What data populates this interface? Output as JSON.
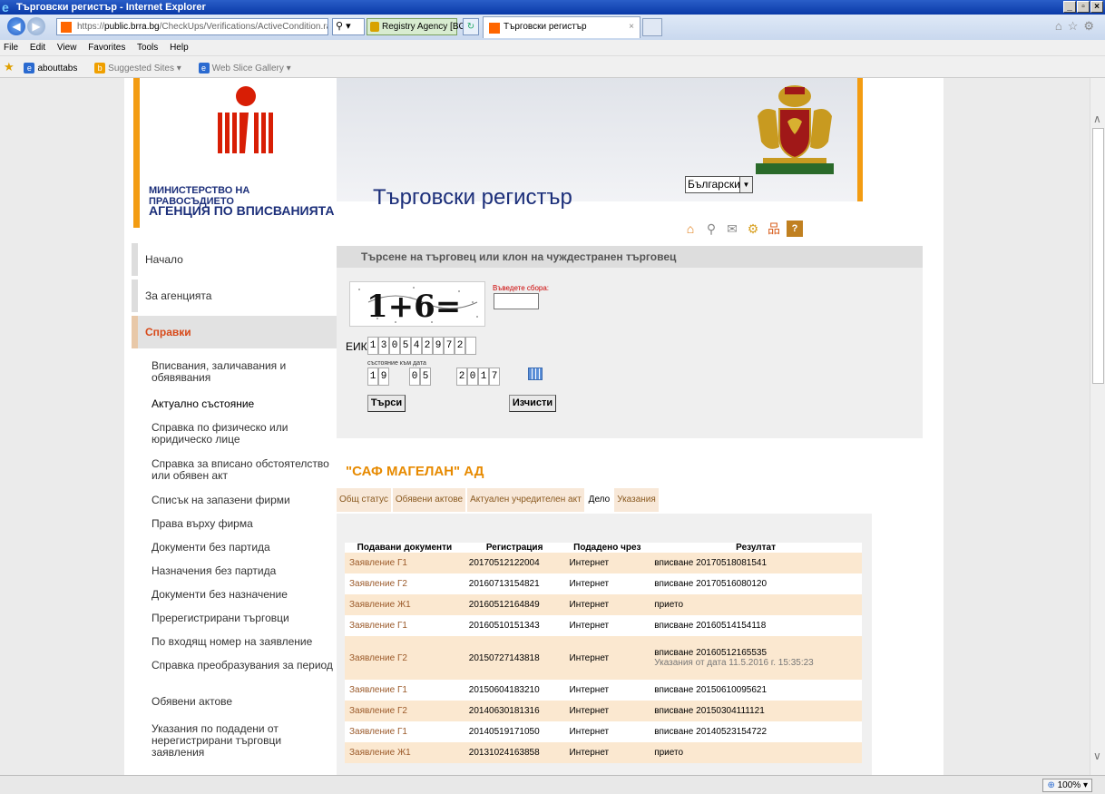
{
  "window": {
    "title": "Търговски регистър - Internet Explorer"
  },
  "browser": {
    "url_prefix": "https://",
    "url_domain": "public.brra.bg",
    "url_path": "/CheckUps/Verifications/ActiveCondition.ra",
    "cert_label": "Registry Agency [BG]",
    "tab_title": "Търговски регистър",
    "menu": [
      "File",
      "Edit",
      "View",
      "Favorites",
      "Tools",
      "Help"
    ],
    "favorites": [
      "abouttabs",
      "Suggested Sites ▾",
      "Web Slice Gallery ▾"
    ],
    "zoom": "100%"
  },
  "header": {
    "ministry": "МИНИСТЕРСТВО НА ПРАВОСЪДИЕТО",
    "agency": "АГЕНЦИЯ ПО ВПИСВАНИЯТА",
    "register_title": "Търговски регистър",
    "language": "Български"
  },
  "sidebar": {
    "home": "Начало",
    "about": "За агенцията",
    "section": "Справки",
    "items": [
      "Вписвания, заличавания и обявявания",
      "Актуално състояние",
      "Справка по физическо или юридическо лице",
      "Справка за вписано обстоятелство или обявен акт",
      "Списък на запазени фирми",
      "Права върху фирма",
      "Документи без партида",
      "Назначения без партида",
      "Документи без назначение",
      "Пререгистрирани търговци",
      "По входящ номер на заявление",
      "Справка преобразувания за период",
      "Обявени актове",
      "Указания по подадени от нерегистрирани търговци заявления"
    ]
  },
  "search": {
    "heading": "Търсене на търговец или клон на чуждестранен търговец",
    "captcha_label": "Въведете сбора:",
    "captcha_text": "1+6=",
    "eik_label": "ЕИК:",
    "eik_digits": [
      "1",
      "3",
      "0",
      "5",
      "4",
      "2",
      "9",
      "7",
      "2",
      ""
    ],
    "date_caption": "състояние към дата",
    "day": [
      "1",
      "9"
    ],
    "month": [
      "0",
      "5"
    ],
    "year": [
      "2",
      "0",
      "1",
      "7"
    ],
    "search_button": "Търси",
    "clear_button": "Изчисти"
  },
  "company": {
    "name": "\"САФ МАГЕЛАН\" АД"
  },
  "tabs": [
    "Общ статус",
    "Обявени актове",
    "Актуален учредителен акт",
    "Дело",
    "Указания"
  ],
  "table": {
    "headers": [
      "Подавани документи",
      "Регистрация",
      "Подадено чрез",
      "Резултат"
    ],
    "rows": [
      {
        "doc": "Заявление Г1",
        "reg": "20170512122004",
        "via": "Интернет",
        "result": "вписване 20170518081541",
        "note": ""
      },
      {
        "doc": "Заявление Г2",
        "reg": "20160713154821",
        "via": "Интернет",
        "result": "вписване 20170516080120",
        "note": ""
      },
      {
        "doc": "Заявление Ж1",
        "reg": "20160512164849",
        "via": "Интернет",
        "result": "прието",
        "note": ""
      },
      {
        "doc": "Заявление Г1",
        "reg": "20160510151343",
        "via": "Интернет",
        "result": "вписване 20160514154118",
        "note": ""
      },
      {
        "doc": "Заявление Г2",
        "reg": "20150727143818",
        "via": "Интернет",
        "result": "вписване 20160512165535",
        "note": "Указания от дата 11.5.2016 г. 15:35:23"
      },
      {
        "doc": "Заявление Г1",
        "reg": "20150604183210",
        "via": "Интернет",
        "result": "вписване 20150610095621",
        "note": ""
      },
      {
        "doc": "Заявление Г2",
        "reg": "20140630181316",
        "via": "Интернет",
        "result": "вписване 20150304111121",
        "note": ""
      },
      {
        "doc": "Заявление Г1",
        "reg": "20140519171050",
        "via": "Интернет",
        "result": "вписване 20140523154722",
        "note": ""
      },
      {
        "doc": "Заявление Ж1",
        "reg": "20131024163858",
        "via": "Интернет",
        "result": "прието",
        "note": ""
      }
    ]
  }
}
